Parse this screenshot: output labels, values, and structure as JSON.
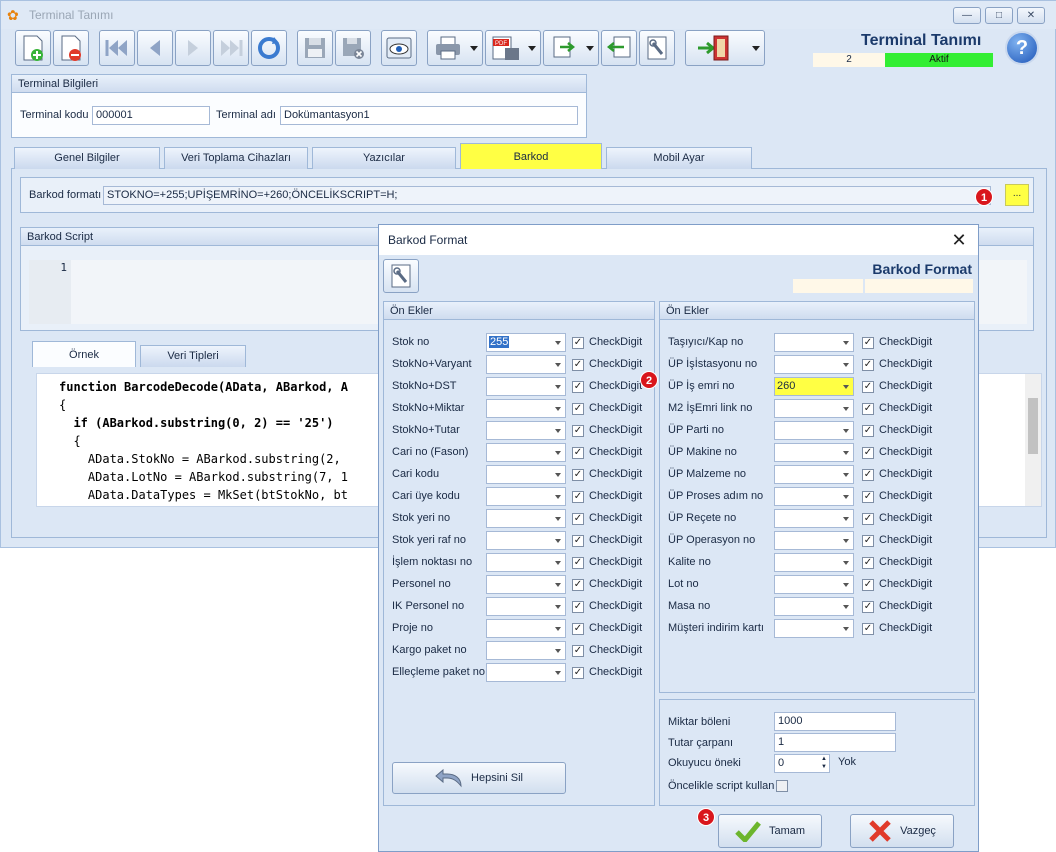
{
  "window": {
    "title": "Terminal Tanımı",
    "minimize": "—",
    "maximize": "□",
    "close": "✕"
  },
  "toolbar": {
    "icons": [
      "new-document-icon",
      "delete-document-icon",
      "first-record-icon",
      "previous-record-icon",
      "next-record-icon",
      "last-record-icon",
      "refresh-icon",
      "save-icon",
      "cancel-save-icon",
      "preview-icon",
      "print-icon",
      "pdf-export-icon",
      "export-icon",
      "import-icon",
      "settings-icon",
      "exit-icon"
    ]
  },
  "header": {
    "title": "Terminal Tanımı",
    "counter": "2",
    "status": "Aktif",
    "status_color": "#33ee33",
    "help": "?"
  },
  "terminal_info": {
    "header": "Terminal Bilgileri",
    "code_label": "Terminal kodu",
    "code_value": "000001",
    "name_label": "Terminal adı",
    "name_value": "Dokümantasyon1"
  },
  "tabs": [
    {
      "label": "Genel Bilgiler"
    },
    {
      "label": "Veri Toplama Cihazları"
    },
    {
      "label": "Yazıcılar"
    },
    {
      "label": "Barkod",
      "active": true
    },
    {
      "label": "Mobil Ayar"
    }
  ],
  "barcode": {
    "format_label": "Barkod formatı",
    "format_value": "STOKNO=+255;UPİŞEMRİNO=+260;ÖNCELİKSCRIPT=H;",
    "ellipsis": "...",
    "script_header": "Barkod Script",
    "line_number": "1"
  },
  "example_tabs": [
    {
      "label": "Örnek",
      "active": true
    },
    {
      "label": "Veri Tipleri"
    }
  ],
  "code_lines": [
    "function BarcodeDecode(AData, ABarkod, A",
    "{",
    "  if (ABarkod.substring(0, 2) == '25')",
    "  {",
    "    AData.StokNo = ABarkod.substring(2,",
    "    AData.LotNo = ABarkod.substring(7, 1",
    "    AData.DataTypes = MkSet(btStokNo, bt"
  ],
  "badges": [
    "1",
    "2",
    "3"
  ],
  "dialog": {
    "title": "Barkod Format",
    "heading": "Barkod Format",
    "close": "✕",
    "left_panel": {
      "header": "Ön Ekler",
      "rows": [
        {
          "label": "Stok no",
          "value": "255",
          "checked": true
        },
        {
          "label": "StokNo+Varyant",
          "value": "",
          "checked": true
        },
        {
          "label": "StokNo+DST",
          "value": "",
          "checked": true
        },
        {
          "label": "StokNo+Miktar",
          "value": "",
          "checked": true
        },
        {
          "label": "StokNo+Tutar",
          "value": "",
          "checked": true
        },
        {
          "label": "Cari no (Fason)",
          "value": "",
          "checked": true
        },
        {
          "label": "Cari kodu",
          "value": "",
          "checked": true
        },
        {
          "label": "Cari üye kodu",
          "value": "",
          "checked": true
        },
        {
          "label": "Stok yeri no",
          "value": "",
          "checked": true
        },
        {
          "label": "Stok yeri raf no",
          "value": "",
          "checked": true
        },
        {
          "label": "İşlem noktası no",
          "value": "",
          "checked": true
        },
        {
          "label": "Personel no",
          "value": "",
          "checked": true
        },
        {
          "label": "IK Personel no",
          "value": "",
          "checked": true
        },
        {
          "label": "Proje no",
          "value": "",
          "checked": true
        },
        {
          "label": "Kargo paket no",
          "value": "",
          "checked": true
        },
        {
          "label": "Elleçleme paket no",
          "value": "",
          "checked": true
        }
      ],
      "check_label": "CheckDigit",
      "clear_all": "Hepsini Sil"
    },
    "right_panel": {
      "header": "Ön Ekler",
      "rows": [
        {
          "label": "Taşıyıcı/Kap no",
          "value": "",
          "checked": true
        },
        {
          "label": "ÜP İşİstasyonu no",
          "value": "",
          "checked": true
        },
        {
          "label": "ÜP İş emri no",
          "value": "260",
          "checked": true,
          "highlight": true
        },
        {
          "label": "M2 İşEmri link no",
          "value": "",
          "checked": true
        },
        {
          "label": "ÜP Parti no",
          "value": "",
          "checked": true
        },
        {
          "label": "ÜP Makine no",
          "value": "",
          "checked": true
        },
        {
          "label": "ÜP Malzeme no",
          "value": "",
          "checked": true
        },
        {
          "label": "ÜP Proses adım no",
          "value": "",
          "checked": true
        },
        {
          "label": "ÜP Reçete no",
          "value": "",
          "checked": true
        },
        {
          "label": "ÜP Operasyon no",
          "value": "",
          "checked": true
        },
        {
          "label": "Kalite no",
          "value": "",
          "checked": true
        },
        {
          "label": "Lot no",
          "value": "",
          "checked": true
        },
        {
          "label": "Masa no",
          "value": "",
          "checked": true
        },
        {
          "label": "Müşteri indirim kartı",
          "value": "",
          "checked": true
        }
      ],
      "check_label": "CheckDigit"
    },
    "settings": {
      "quantity_divisor_label": "Miktar böleni",
      "quantity_divisor": "1000",
      "amount_multiplier_label": "Tutar çarpanı",
      "amount_multiplier": "1",
      "reader_prefix_label": "Okuyucu öneki",
      "reader_prefix": "0",
      "reader_prefix_suffix": "Yok",
      "script_first_label": "Öncelikle script kullan"
    },
    "ok_label": "Tamam",
    "cancel_label": "Vazgeç"
  }
}
